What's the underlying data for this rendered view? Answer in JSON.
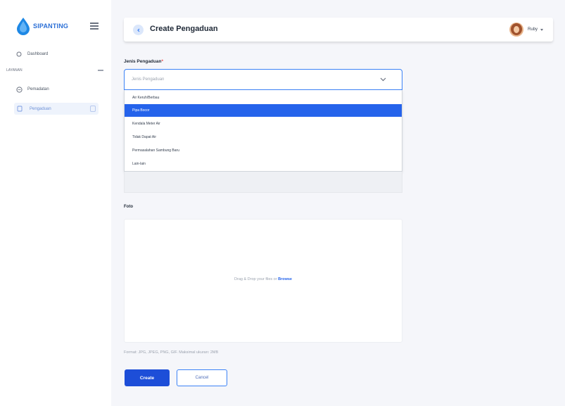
{
  "sidebar": {
    "logo_text": "SIPANTING",
    "items": [
      {
        "label": "Dashboard",
        "icon": "dashboard-icon"
      },
      {
        "label": "Pemadatan",
        "icon": "circle-icon"
      }
    ],
    "group_label": "LAYANAN",
    "active_item": {
      "label": "Pengaduan",
      "icon": "document-icon"
    }
  },
  "header": {
    "title": "Create Pengaduan",
    "user_name": "Ruby"
  },
  "form": {
    "jenis_label": "Jenis Pengaduan",
    "required_marker": "*",
    "jenis_placeholder": "Jenis Pengaduan",
    "options": [
      "Air Keruh/Berbau",
      "Pipa Bocor",
      "Kendala Meter Air",
      "Tidak Dapat Air",
      "Permasalahan Sambung Baru",
      "Lain-lain"
    ],
    "selected_index": 1,
    "foto_label": "Foto",
    "upload_text": "Drag & Drop your files or",
    "upload_browse": "Browse",
    "hint": "Format: JPG, JPEG, PNG, GIF. Maksimal ukuran: 2MB",
    "create_label": "Create",
    "cancel_label": "Cancel"
  },
  "colors": {
    "accent": "#2563eb",
    "selected_option": "#2563eb",
    "create_button": "#1d4ed8"
  }
}
